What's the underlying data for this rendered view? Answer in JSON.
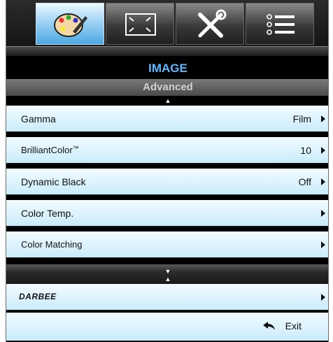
{
  "tabs": [
    {
      "icon": "palette-icon",
      "active": true
    },
    {
      "icon": "screen-resize-icon",
      "active": false
    },
    {
      "icon": "tools-icon",
      "active": false
    },
    {
      "icon": "list-icon",
      "active": false
    }
  ],
  "header": {
    "title": "IMAGE",
    "subtitle": "Advanced"
  },
  "menu": {
    "items": [
      {
        "label": "Gamma",
        "value": "Film"
      },
      {
        "label": "BrilliantColor",
        "label_suffix": "™",
        "value": "10"
      },
      {
        "label": "Dynamic Black",
        "value": "Off"
      },
      {
        "label": "Color Temp.",
        "value": ""
      },
      {
        "label": "Color Matching",
        "value": ""
      }
    ],
    "darbee_label": "DARBEE",
    "exit_label": "Exit"
  },
  "colors": {
    "accent": "#5fb8ff",
    "row_bg": "#c9ecfb",
    "active_tab": "#4aa8e0"
  }
}
